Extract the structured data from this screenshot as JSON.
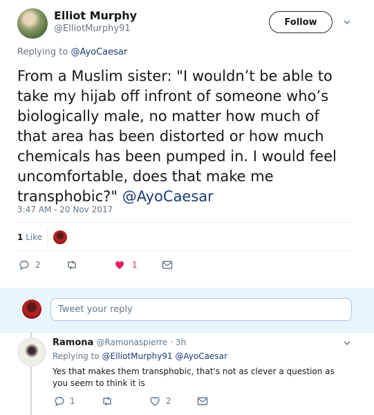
{
  "author": {
    "name": "Elliot Murphy",
    "handle": "@ElliotMurphy91",
    "follow_label": "Follow"
  },
  "tweet": {
    "replying_label": "Replying to",
    "replying_to": "@AyoCaesar",
    "text": "From a Muslim sister: \"I wouldn’t be able to take my hijab off infront of someone who’s biologically male, no matter how much of that area has been distorted or  how much chemicals has been pumped in. I would feel uncomfortable, does that make me transphobic?\"",
    "mention": "@AyoCaesar",
    "timestamp": "3:47 AM - 20 Nov 2017",
    "likes_count": "1",
    "likes_label": "Like",
    "actions": {
      "reply_count": "2",
      "retweet_count": "",
      "like_count": "1"
    }
  },
  "reply_box": {
    "placeholder": "Tweet your reply"
  },
  "reply": {
    "name": "Ramona",
    "handle": "@Ramonaspierre",
    "time": "· 3h",
    "replying_label": "Replying to",
    "replying_to": "@ElliotMurphy91 @AyoCaesar",
    "text": "Yes that makes them transphobic, that's not as clever a question as you seem to think it is",
    "actions": {
      "reply_count": "1",
      "retweet_count": "",
      "like_count": "2"
    }
  },
  "colors": {
    "heart": "#e0245e",
    "accent_link": "#1b3a73",
    "reply_bar": "#e8f5fd"
  }
}
